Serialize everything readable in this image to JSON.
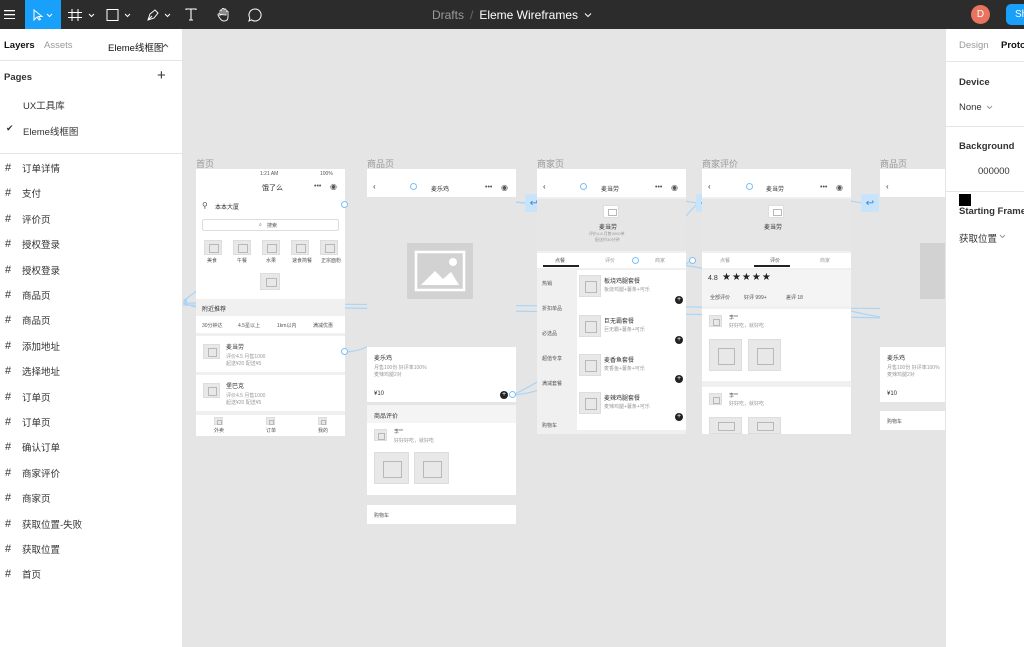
{
  "toolbar": {
    "breadcrumb_drafts": "Drafts",
    "separator": "/",
    "file_name": "Eleme Wireframes",
    "avatar_initial": "D",
    "share_label": "Sh",
    "tools": [
      "menu-icon",
      "move-tool-icon",
      "frame-tool-icon",
      "shape-tool-icon",
      "pen-tool-icon",
      "text-tool-icon",
      "hand-tool-icon",
      "comment-tool-icon"
    ],
    "active_color": "#18a0fb"
  },
  "left_panel": {
    "tab_layers": "Layers",
    "tab_assets": "Assets",
    "page_selector": "Eleme线框图",
    "pages_heading": "Pages",
    "add_page": "+",
    "pages": [
      {
        "label": "UX工具库",
        "selected": false
      },
      {
        "label": "Eleme线框图",
        "selected": true
      }
    ],
    "layers": [
      "订单详情",
      "支付",
      "评价页",
      "授权登录",
      "授权登录",
      "商品页",
      "商品页",
      "添加地址",
      "选择地址",
      "订单页",
      "订单页",
      "确认订单",
      "商家评价",
      "商家页",
      "获取位置-失败",
      "获取位置",
      "首页"
    ]
  },
  "canvas": {
    "frame_labels": [
      "首页",
      "商品页",
      "商家页",
      "商家评价",
      "商品页"
    ],
    "home": {
      "status_time": "1:21 AM",
      "status_battery": "100%",
      "title": "饿了么",
      "location": "本本大厦",
      "search_placeholder": "搜索",
      "categories": [
        "美食",
        "午餐",
        "水果",
        "速食简餐",
        "正宗面粉"
      ],
      "section_title": "附近推荐",
      "filters": [
        "30分钟达",
        "4.5星以上",
        "1km以内",
        "满减优惠"
      ],
      "shop1_name": "麦当劳",
      "shop1_meta": "评价4.5  月售1000",
      "shop1_meta2": "起送¥20  配送¥5",
      "shop2_name": "堡巴克",
      "shop2_meta": "评价4.5  月售1000",
      "shop2_meta2": "起送¥20  配送¥5",
      "tabs": [
        "外卖",
        "订单",
        "我的"
      ]
    },
    "product": {
      "title": "麦乐鸡",
      "name": "麦乐鸡",
      "meta1": "月售100份  好评率100%",
      "meta2": "麦辣鸡腿2对",
      "price": "¥10",
      "review_title": "商品评价",
      "reviewer": "李**",
      "review_text": "好好好吃，就好吃",
      "cart": "购物车"
    },
    "merchant": {
      "title": "麦当劳",
      "shop_name": "麦当劳",
      "shop_meta": "评价4.8  月售3000单",
      "shop_meta2": "配送约30分钟",
      "tabs": [
        "点餐",
        "评价",
        "商家"
      ],
      "menu_cats": [
        "热销",
        "折扣单品",
        "必选品",
        "超值专享",
        "满减套餐",
        "购物车"
      ],
      "items": [
        {
          "name": "板烧鸡腿套餐",
          "desc": "板烧鸡腿+薯条+可乐"
        },
        {
          "name": "巨无霸套餐",
          "desc": "巨无霸+薯条+可乐"
        },
        {
          "name": "麦香鱼套餐",
          "desc": "麦香鱼+薯条+可乐"
        },
        {
          "name": "麦辣鸡腿套餐",
          "desc": "麦辣鸡腿+薯条+可乐"
        }
      ]
    },
    "merchant_review": {
      "title": "麦当劳",
      "shop_name": "麦当劳",
      "tabs": [
        "点餐",
        "评价",
        "商家"
      ],
      "score": "4.8",
      "stars": 5,
      "filters": [
        "全部评价",
        "好评 999+",
        "差评 18"
      ],
      "reviewer1": "李**",
      "review1": "好好吃，就好吃",
      "reviewer2": "李**",
      "review2": "好好吃，就好吃"
    },
    "product2": {
      "name": "麦乐鸡",
      "meta1": "月售100份  好评率100%",
      "meta2": "麦辣鸡腿2对",
      "price": "¥10",
      "cart": "购物车"
    }
  },
  "right_panel": {
    "tab_design": "Design",
    "tab_prototype": "Proto",
    "device_heading": "Device",
    "device_value": "None",
    "background_heading": "Background",
    "background_value": "000000",
    "starting_frame_heading": "Starting Frame",
    "starting_frame_value": "获取位置"
  }
}
